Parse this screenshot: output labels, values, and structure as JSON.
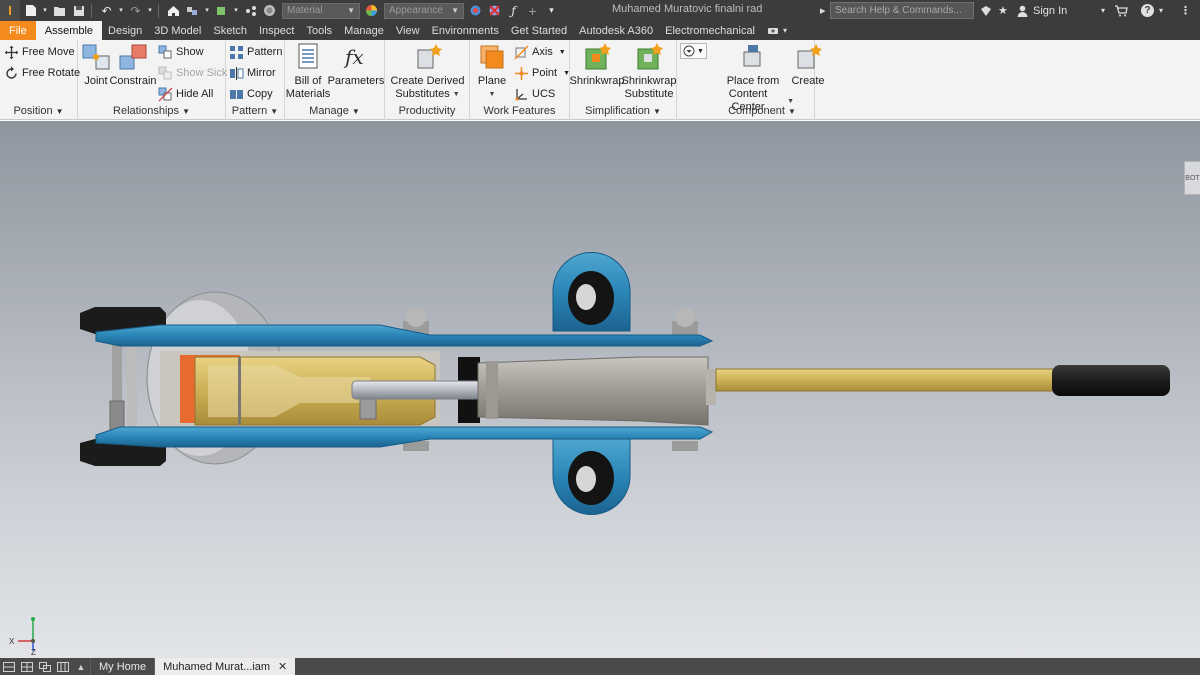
{
  "app": {
    "document_title": "Muhamed Muratovic finalni rad",
    "search_placeholder": "Search Help & Commands...",
    "sign_in": "Sign In",
    "material_dropdown": "Material",
    "appearance_dropdown": "Appearance",
    "accent_color": "#f28a1e"
  },
  "tabs": [
    {
      "label": "File"
    },
    {
      "label": "Assemble"
    },
    {
      "label": "Design"
    },
    {
      "label": "3D Model"
    },
    {
      "label": "Sketch"
    },
    {
      "label": "Inspect"
    },
    {
      "label": "Tools"
    },
    {
      "label": "Manage"
    },
    {
      "label": "View"
    },
    {
      "label": "Environments"
    },
    {
      "label": "Get Started"
    },
    {
      "label": "Autodesk A360"
    },
    {
      "label": "Electromechanical"
    }
  ],
  "ribbon": {
    "position": {
      "label": "Position",
      "free_move": "Free Move",
      "free_rotate": "Free Rotate"
    },
    "relationships": {
      "label": "Relationships",
      "joint": "Joint",
      "constrain": "Constrain",
      "show": "Show",
      "show_sick": "Show Sick",
      "hide_all": "Hide All"
    },
    "pattern": {
      "label": "Pattern",
      "pattern": "Pattern",
      "mirror": "Mirror",
      "copy": "Copy"
    },
    "manage": {
      "label": "Manage",
      "bom_line1": "Bill of",
      "bom_line2": "Materials",
      "parameters": "Parameters"
    },
    "productivity": {
      "label": "Productivity",
      "cds_line1": "Create Derived",
      "cds_line2": "Substitutes"
    },
    "work_features": {
      "label": "Work Features",
      "plane": "Plane",
      "axis": "Axis",
      "point": "Point",
      "ucs": "UCS"
    },
    "simplification": {
      "label": "Simplification",
      "shrinkwrap": "Shrinkwrap",
      "sws_line1": "Shrinkwrap",
      "sws_line2": "Substitute"
    },
    "component": {
      "label": "Component",
      "pfcc_line1": "Place from",
      "pfcc_line2": "Content Center",
      "create": "Create"
    }
  },
  "viewport": {
    "nav_tab": "BOT",
    "triad": {
      "x": "X",
      "z": "Z"
    }
  },
  "doc_tabs": [
    {
      "label": "My Home"
    },
    {
      "label": "Muhamed Murat...iam"
    }
  ],
  "icons": [
    "inventor-logo-icon",
    "new-icon",
    "open-icon",
    "save-icon",
    "undo-icon",
    "redo-icon",
    "home-icon",
    "help-icon",
    "cart-icon",
    "user-icon"
  ]
}
